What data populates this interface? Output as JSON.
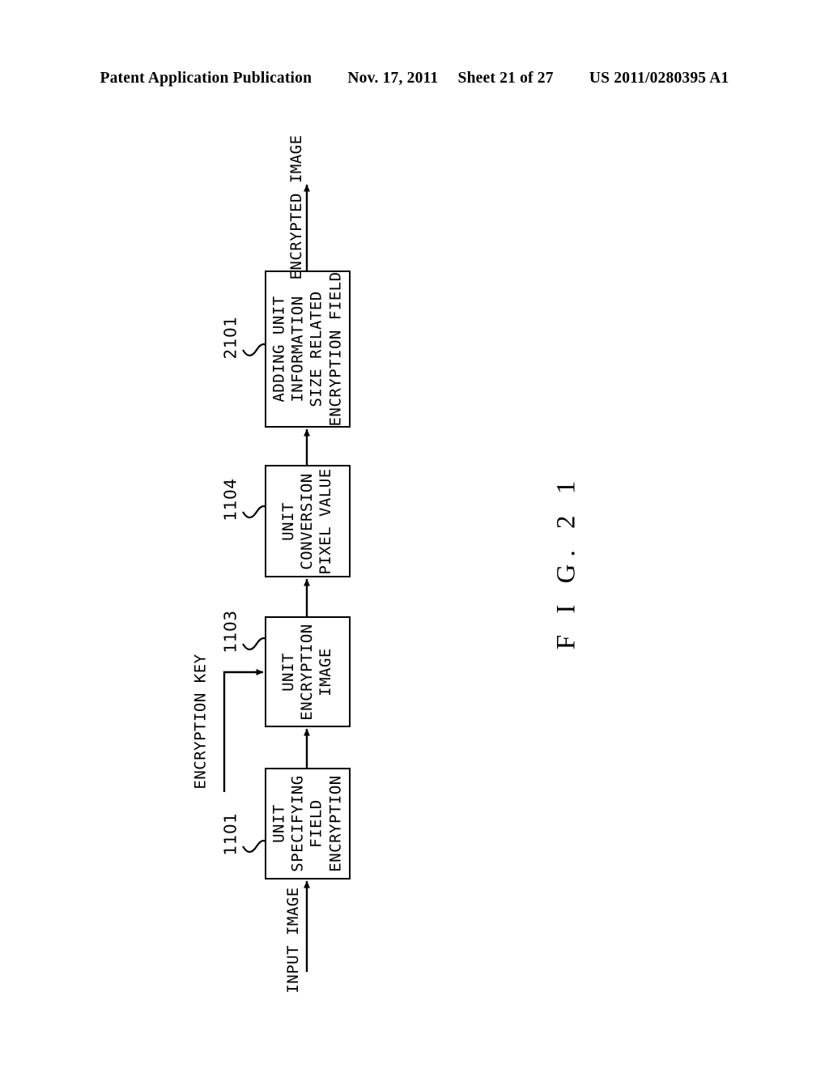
{
  "header": {
    "publication": "Patent Application Publication",
    "date": "Nov. 17, 2011",
    "sheet": "Sheet 21 of 27",
    "patent_number": "US 2011/0280395 A1"
  },
  "figure": {
    "caption": "F I G.  2 1",
    "orientation": "rotated-90-ccw",
    "blocks": [
      {
        "ref": "2101",
        "lines": [
          "ENCRYPTION FIELD",
          "SIZE RELATED",
          "INFORMATION",
          "ADDING UNIT"
        ]
      },
      {
        "ref": "1104",
        "lines": [
          "PIXEL VALUE",
          "CONVERSION",
          "UNIT"
        ]
      },
      {
        "ref": "1103",
        "lines": [
          "IMAGE",
          "ENCRYPTION",
          "UNIT"
        ]
      },
      {
        "ref": "1101",
        "lines": [
          "ENCRYPTION",
          "FIELD",
          "SPECIFYING",
          "UNIT"
        ]
      }
    ],
    "flow_labels": {
      "output": "ENCRYPTED IMAGE",
      "key": "ENCRYPTION KEY",
      "input": "INPUT IMAGE"
    }
  },
  "colors": {
    "ink": "#000000",
    "paper": "#ffffff"
  }
}
